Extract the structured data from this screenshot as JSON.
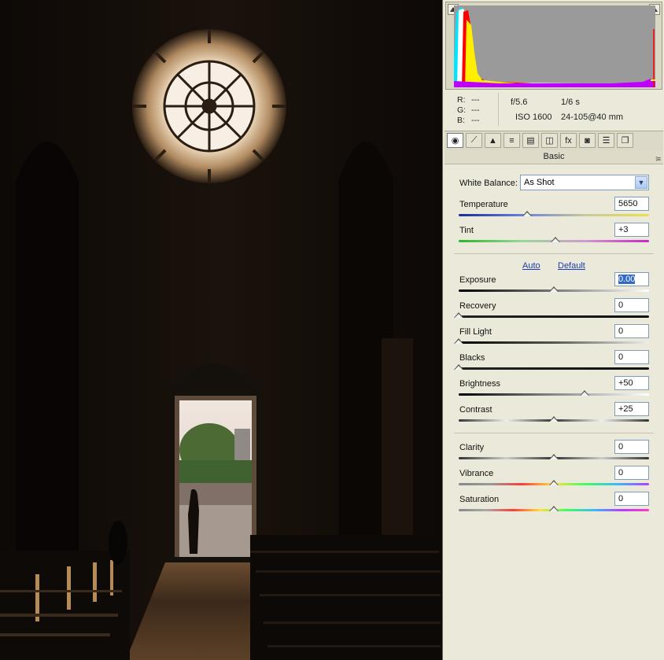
{
  "histogram": {
    "readout": {
      "r_label": "R:",
      "g_label": "G:",
      "b_label": "B:",
      "r": "---",
      "g": "---",
      "b": "---"
    },
    "aperture": "f/5.6",
    "shutter": "1/6 s",
    "iso": "ISO 1600",
    "lens": "24-105@40 mm"
  },
  "tabs": [
    {
      "icon": "aperture-icon",
      "glyph": "◉"
    },
    {
      "icon": "tone-curve-icon",
      "glyph": "⟋"
    },
    {
      "icon": "detail-icon",
      "glyph": "▲"
    },
    {
      "icon": "hsl-icon",
      "glyph": "≡"
    },
    {
      "icon": "split-toning-icon",
      "glyph": "▤"
    },
    {
      "icon": "lens-corrections-icon",
      "glyph": "◫"
    },
    {
      "icon": "effects-icon",
      "glyph": "fx"
    },
    {
      "icon": "camera-calibration-icon",
      "glyph": "◙"
    },
    {
      "icon": "presets-icon",
      "glyph": "☰"
    },
    {
      "icon": "snapshots-icon",
      "glyph": "❐"
    }
  ],
  "section": {
    "title": "Basic",
    "menu_glyph": "⁝≡"
  },
  "white_balance": {
    "label": "White Balance:",
    "value": "As Shot",
    "arrow": "▼"
  },
  "links": {
    "auto": "Auto",
    "default": "Default"
  },
  "sliders": [
    {
      "id": "temperature",
      "label": "Temperature",
      "value": "5650",
      "position": 0.36
    },
    {
      "id": "tint",
      "label": "Tint",
      "value": "+3",
      "position": 0.51
    },
    {
      "id": "exposure",
      "label": "Exposure",
      "value": "0.00",
      "position": 0.5
    },
    {
      "id": "recovery",
      "label": "Recovery",
      "value": "0",
      "position": 0.0
    },
    {
      "id": "fill-light",
      "label": "Fill Light",
      "value": "0",
      "position": 0.0
    },
    {
      "id": "blacks",
      "label": "Blacks",
      "value": "0",
      "position": 0.0
    },
    {
      "id": "brightness",
      "label": "Brightness",
      "value": "+50",
      "position": 0.66
    },
    {
      "id": "contrast",
      "label": "Contrast",
      "value": "+25",
      "position": 0.5
    },
    {
      "id": "clarity",
      "label": "Clarity",
      "value": "0",
      "position": 0.5
    },
    {
      "id": "vibrance",
      "label": "Vibrance",
      "value": "0",
      "position": 0.5
    },
    {
      "id": "saturation",
      "label": "Saturation",
      "value": "0",
      "position": 0.5
    }
  ],
  "colors": {
    "panel_bg": "#ebe9d9",
    "histogram_bg": "#9a9a9a",
    "link": "#1a3cb0",
    "selection": "#316ac5"
  }
}
